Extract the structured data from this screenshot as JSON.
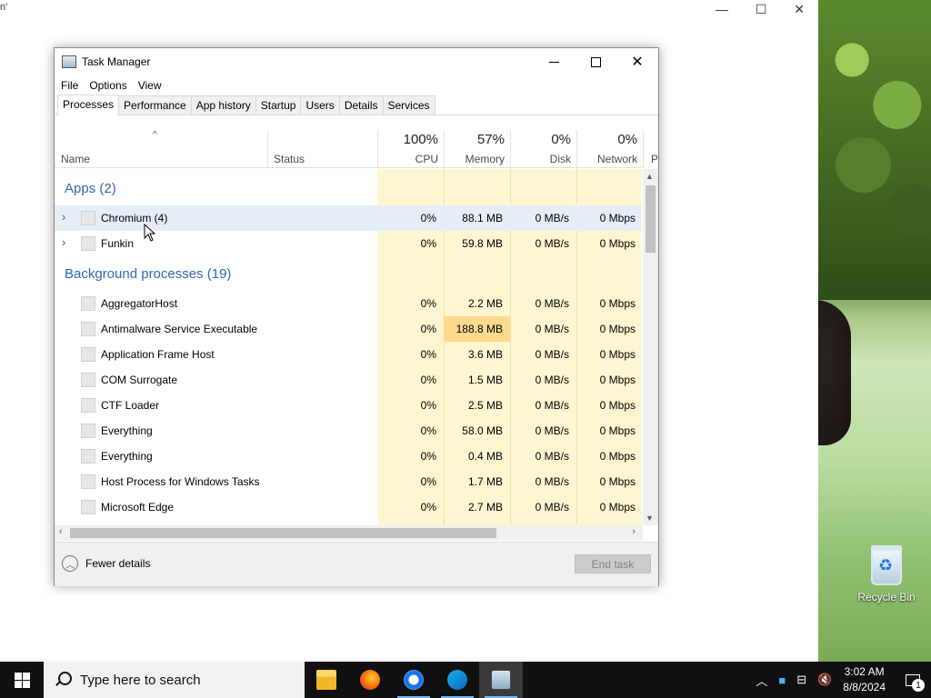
{
  "background_window": {
    "title_tail": "n'"
  },
  "desktop": {
    "recycle_bin_label": "Recycle Bin"
  },
  "window": {
    "title": "Task Manager"
  },
  "menu": [
    "File",
    "Options",
    "View"
  ],
  "tabs": [
    "Processes",
    "Performance",
    "App history",
    "Startup",
    "Users",
    "Details",
    "Services"
  ],
  "active_tab": "Processes",
  "columns": {
    "name": "Name",
    "status": "Status",
    "cpu": {
      "pct": "100%",
      "label": "CPU"
    },
    "memory": {
      "pct": "57%",
      "label": "Memory"
    },
    "disk": {
      "pct": "0%",
      "label": "Disk"
    },
    "network": {
      "pct": "0%",
      "label": "Network"
    },
    "next": "P"
  },
  "groups": {
    "apps": "Apps (2)",
    "background": "Background processes (19)"
  },
  "apps": [
    {
      "name": "Chromium (4)",
      "cpu": "0%",
      "memory": "88.1 MB",
      "disk": "0 MB/s",
      "network": "0 Mbps"
    },
    {
      "name": "Funkin",
      "cpu": "0%",
      "memory": "59.8 MB",
      "disk": "0 MB/s",
      "network": "0 Mbps"
    }
  ],
  "background": [
    {
      "name": "AggregatorHost",
      "cpu": "0%",
      "memory": "2.2 MB",
      "disk": "0 MB/s",
      "network": "0 Mbps"
    },
    {
      "name": "Antimalware Service Executable",
      "cpu": "0%",
      "memory": "188.8 MB",
      "disk": "0 MB/s",
      "network": "0 Mbps"
    },
    {
      "name": "Application Frame Host",
      "cpu": "0%",
      "memory": "3.6 MB",
      "disk": "0 MB/s",
      "network": "0 Mbps"
    },
    {
      "name": "COM Surrogate",
      "cpu": "0%",
      "memory": "1.5 MB",
      "disk": "0 MB/s",
      "network": "0 Mbps"
    },
    {
      "name": "CTF Loader",
      "cpu": "0%",
      "memory": "2.5 MB",
      "disk": "0 MB/s",
      "network": "0 Mbps"
    },
    {
      "name": "Everything",
      "cpu": "0%",
      "memory": "58.0 MB",
      "disk": "0 MB/s",
      "network": "0 Mbps"
    },
    {
      "name": "Everything",
      "cpu": "0%",
      "memory": "0.4 MB",
      "disk": "0 MB/s",
      "network": "0 Mbps"
    },
    {
      "name": "Host Process for Windows Tasks",
      "cpu": "0%",
      "memory": "1.7 MB",
      "disk": "0 MB/s",
      "network": "0 Mbps"
    },
    {
      "name": "Microsoft Edge",
      "cpu": "0%",
      "memory": "2.7 MB",
      "disk": "0 MB/s",
      "network": "0 Mbps"
    }
  ],
  "footer": {
    "fewer_details": "Fewer details",
    "end_task": "End task"
  },
  "taskbar": {
    "search_placeholder": "Type here to search",
    "time": "3:02 AM",
    "date": "8/8/2024",
    "notification_count": "1"
  },
  "colors": {
    "accent_group": "#2d6bb2",
    "heat_light": "#fff5d1",
    "heat_high": "#ffd98e",
    "taskbar": "#101010"
  }
}
